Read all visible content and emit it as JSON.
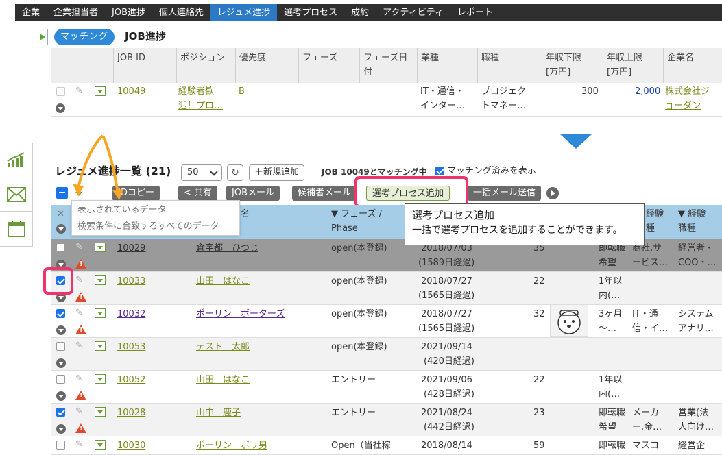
{
  "nav": {
    "tabs": [
      "企業",
      "企業担当者",
      "JOB進捗",
      "個人連絡先",
      "レジュメ進捗",
      "選考プロセス",
      "成約",
      "アクティビティ",
      "レポート"
    ],
    "active_index": 4
  },
  "matching": {
    "pill": "マッチング",
    "title": "JOB進捗"
  },
  "job_table": {
    "headers": [
      "JOB ID",
      "ポジション",
      "優先度",
      "フェーズ",
      "フェーズ日付",
      "業種",
      "職種",
      "年収下限\n[万円]",
      "年収上限\n[万円]",
      "企業名"
    ],
    "row": {
      "id": "10049",
      "position_l1": "経験者歓",
      "position_l2": "迎！プロ…",
      "priority": "B",
      "industry_l1": "IT・通信・",
      "industry_l2": "インター…",
      "jobtype_l1": "プロジェク",
      "jobtype_l2": "トマネー…",
      "salary_min": "300",
      "salary_max": "2,000",
      "company_l1": "株式会社ジ",
      "company_l2": "ョーダン"
    }
  },
  "list": {
    "title": "レジュメ進捗一覧 (21)",
    "page_size": "50",
    "new_button": "＋新規追加",
    "match_info": "JOB 10049とマッチング中",
    "show_matched_label": "マッチング済みを表示"
  },
  "toolbar": {
    "id_copy": "IDコピー",
    "share": "共有",
    "job_mail": "JOBメール",
    "candidate_mail": "候補者メール",
    "add_process": "選考プロセス追加",
    "bulk_mail": "一括メール送信"
  },
  "dropdown_options": [
    "表示されているデータ",
    "検索条件に合致するすべてのデータ"
  ],
  "tooltip": {
    "title": "選考プロセス追加",
    "body": "一括で選考プロセスを追加することができます。"
  },
  "main_headers": {
    "name": "名",
    "phase_l1": "▼ フェーズ /",
    "phase_l2": "Phase",
    "exp_l1": "経験",
    "exp_l2": "種",
    "exp2_l1": "▼ 経験",
    "exp2_l2": "職種"
  },
  "rows": [
    {
      "id": "10029",
      "name": "倉宇都　ひつじ",
      "phase": "open(本登録)",
      "date": "2018/07/03",
      "elapsed": "(1589日経過)",
      "age": "35",
      "c1_l1": "即転職",
      "c1_l2": "希望",
      "c2_l1": "商社,サ",
      "c2_l2": "ービス…",
      "c3_l1": "経営者・",
      "c3_l2": "COO・…",
      "checked": false
    },
    {
      "id": "10033",
      "name": "山田　はなこ",
      "phase": "open(本登録)",
      "date": "2018/07/27",
      "elapsed": "(1565日経過)",
      "age": "22",
      "c1_l1": "1年以",
      "c1_l2": "内(…",
      "c2_l1": "",
      "c2_l2": "",
      "c3_l1": "",
      "c3_l2": "",
      "checked": true
    },
    {
      "id": "10032",
      "name": "ポーリン　ポーターズ",
      "phase": "open(本登録)",
      "date": "2018/07/27",
      "elapsed": "(1565日経過)",
      "age": "32",
      "c1_l1": "3ヶ月",
      "c1_l2": "～…",
      "c2_l1": "IT・通",
      "c2_l2": "信・イ…",
      "c3_l1": "システム",
      "c3_l2": "アナリ…",
      "checked": true
    },
    {
      "id": "10053",
      "name": "テスト　太郎",
      "phase": "open(本登録)",
      "date": "2021/09/14",
      "elapsed": "(420日経過)",
      "age": "",
      "c1_l1": "",
      "c1_l2": "",
      "c2_l1": "",
      "c2_l2": "",
      "c3_l1": "",
      "c3_l2": "",
      "checked": false
    },
    {
      "id": "10052",
      "name": "山田　はなこ",
      "phase": "エントリー",
      "date": "2021/09/06",
      "elapsed": "(428日経過)",
      "age": "22",
      "c1_l1": "1年以",
      "c1_l2": "内(…",
      "c2_l1": "",
      "c2_l2": "",
      "c3_l1": "",
      "c3_l2": "",
      "checked": false
    },
    {
      "id": "10028",
      "name": "山中　鹿子",
      "phase": "エントリー",
      "date": "2021/08/24",
      "elapsed": "(442日経過)",
      "age": "23",
      "c1_l1": "即転職",
      "c1_l2": "希望",
      "c2_l1": "メーカ",
      "c2_l2": "ー,金…",
      "c3_l1": "営業(法",
      "c3_l2": "人向け…",
      "checked": true
    },
    {
      "id": "10030",
      "name": "ポーリン　ポリ男",
      "phase": "Open（当社稼",
      "date": "2018/08/14",
      "elapsed": "",
      "age": "59",
      "c1_l1": "即転職",
      "c1_l2": "",
      "c2_l1": "マスコ",
      "c2_l2": "",
      "c3_l1": "経営企",
      "c3_l2": "",
      "checked": false
    }
  ],
  "colors": {
    "nav_bg": "#2f2f2f",
    "nav_active": "#2c7ac6",
    "accent_blue": "#2e89d8",
    "highlight_pink": "#f0336b",
    "annotation_orange": "#f5a623",
    "header_blue": "#a5cde8",
    "link_olive": "#7c8a1c"
  }
}
